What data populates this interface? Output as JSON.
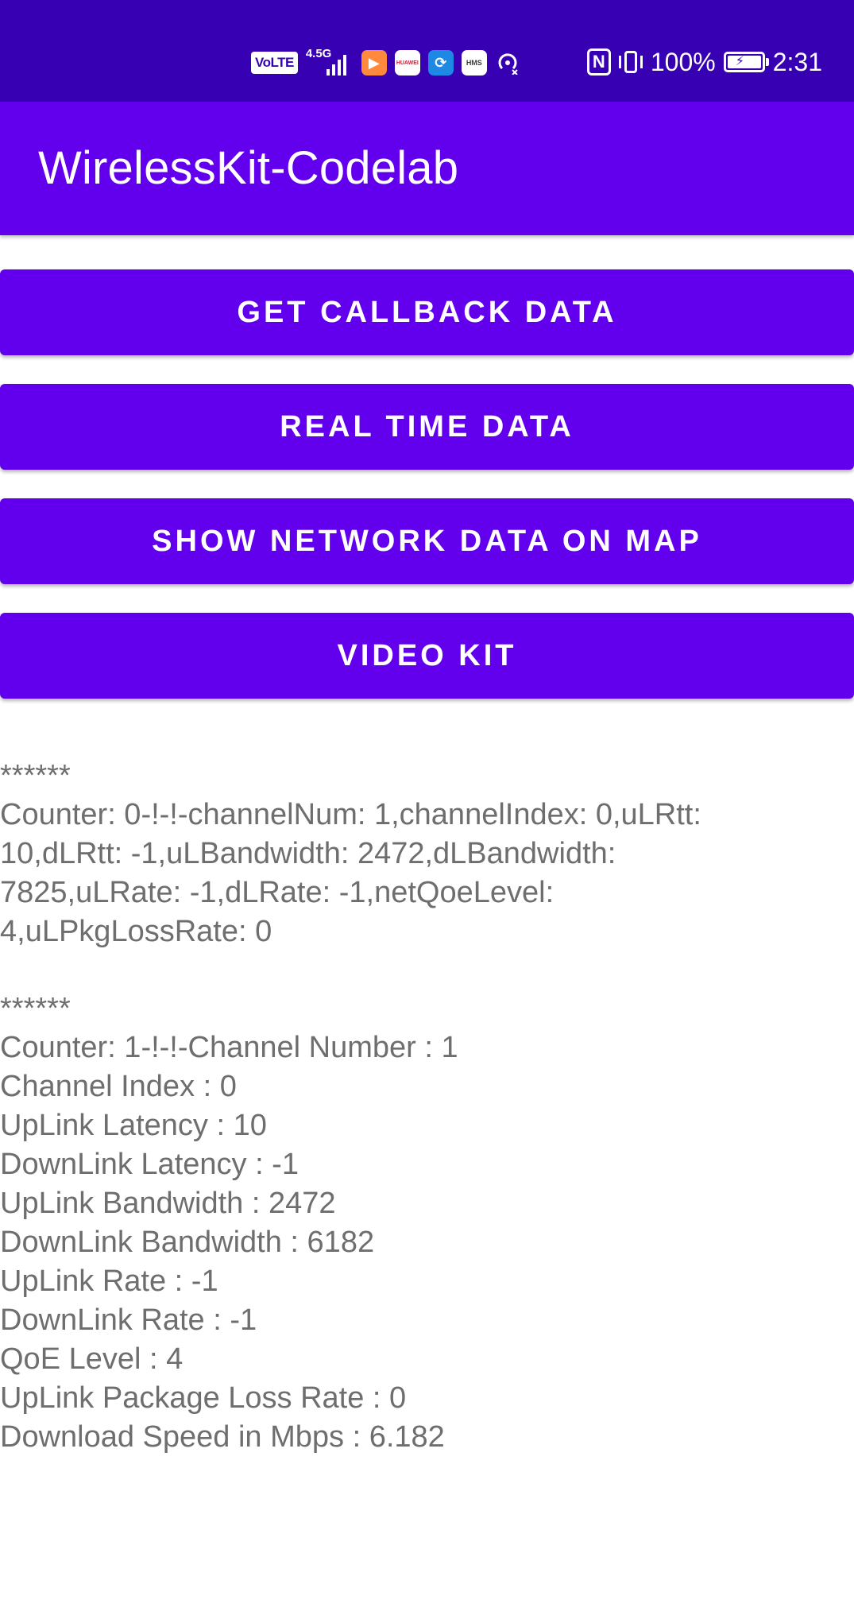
{
  "status_bar": {
    "volte_label": "VoLTE",
    "network_label": "4.5G",
    "app_icons": [
      "play-app-icon",
      "huawei-store-icon",
      "blue-app-icon",
      "hms-icon"
    ],
    "store_label": "HUAWEI",
    "hms_label": "HMS",
    "nfc_label": "N",
    "battery_percent_text": "100%",
    "battery_level": 1.0,
    "time": "2:31"
  },
  "app_bar": {
    "title": "WirelessKit-Codelab"
  },
  "buttons": {
    "get_callback": "GET CALLBACK DATA",
    "real_time": "REAL TIME DATA",
    "show_map": "SHOW NETWORK DATA ON MAP",
    "video_kit": "VIDEO KIT"
  },
  "output": {
    "block1": {
      "separator": "******",
      "lines": [
        "Counter: 0-!-!-channelNum: 1,channelIndex: 0,uLRtt:",
        "10,dLRtt: -1,uLBandwidth: 2472,dLBandwidth:",
        "7825,uLRate: -1,dLRate: -1,netQoeLevel:",
        "4,uLPkgLossRate: 0"
      ]
    },
    "block2": {
      "separator": "******",
      "lines": [
        "Counter: 1-!-!-Channel Number : 1",
        "Channel Index : 0",
        "UpLink Latency : 10",
        "DownLink Latency : -1",
        "UpLink Bandwidth : 2472",
        "DownLink Bandwidth : 6182",
        "UpLink Rate : -1",
        "DownLink Rate : -1",
        "QoE Level : 4",
        "UpLink Package Loss Rate : 0",
        "Download Speed in Mbps : 6.182"
      ]
    }
  },
  "colors": {
    "status_bar": "#3700b3",
    "primary": "#6200ee",
    "output_text": "#6e6e6e"
  }
}
